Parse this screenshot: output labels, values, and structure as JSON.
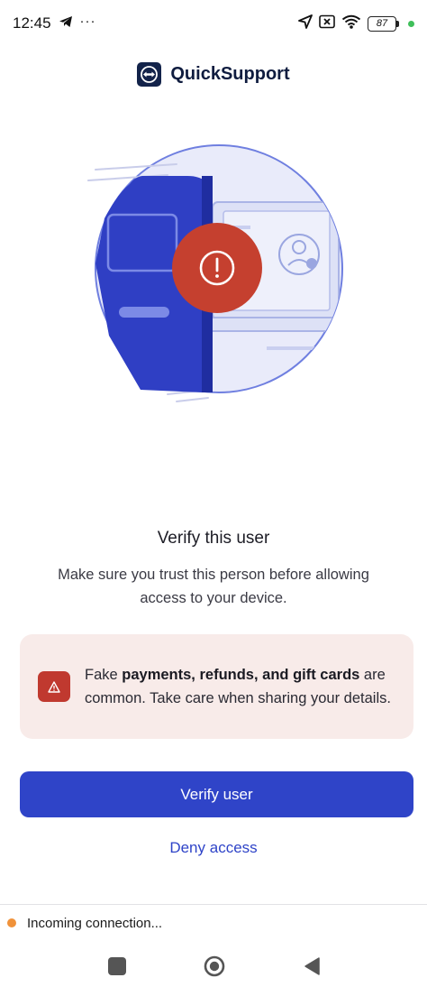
{
  "status_bar": {
    "time": "12:45",
    "dots": "···",
    "battery": "87",
    "icons": [
      "telegram-icon",
      "location-icon",
      "close-box-icon",
      "wifi-icon",
      "battery-icon"
    ]
  },
  "app": {
    "name": "QuickSupport",
    "logo_icon": "teamviewer-logo-icon"
  },
  "illustration": {
    "alert_icon": "exclamation-icon",
    "colors": {
      "phone": "#2f3fc4",
      "circle_bg": "#e8eaf9",
      "circle_stroke": "#6f7fe0",
      "alert": "#c5402f"
    }
  },
  "main": {
    "title": "Verify this user",
    "subtitle": "Make sure you trust this person before allowing access to your device."
  },
  "warning": {
    "prefix": "Fake ",
    "bold": "payments, refunds, and gift cards",
    "suffix": " are common. Take care when sharing your details.",
    "icon": "warning-triangle-icon",
    "color": "#c0392f"
  },
  "actions": {
    "verify_label": "Verify user",
    "deny_label": "Deny access",
    "accent": "#2f44c8"
  },
  "notification": {
    "text": "Incoming connection...",
    "dot_color": "#f0923a"
  },
  "nav": {
    "items": [
      "recents-icon",
      "home-icon",
      "back-icon"
    ]
  }
}
